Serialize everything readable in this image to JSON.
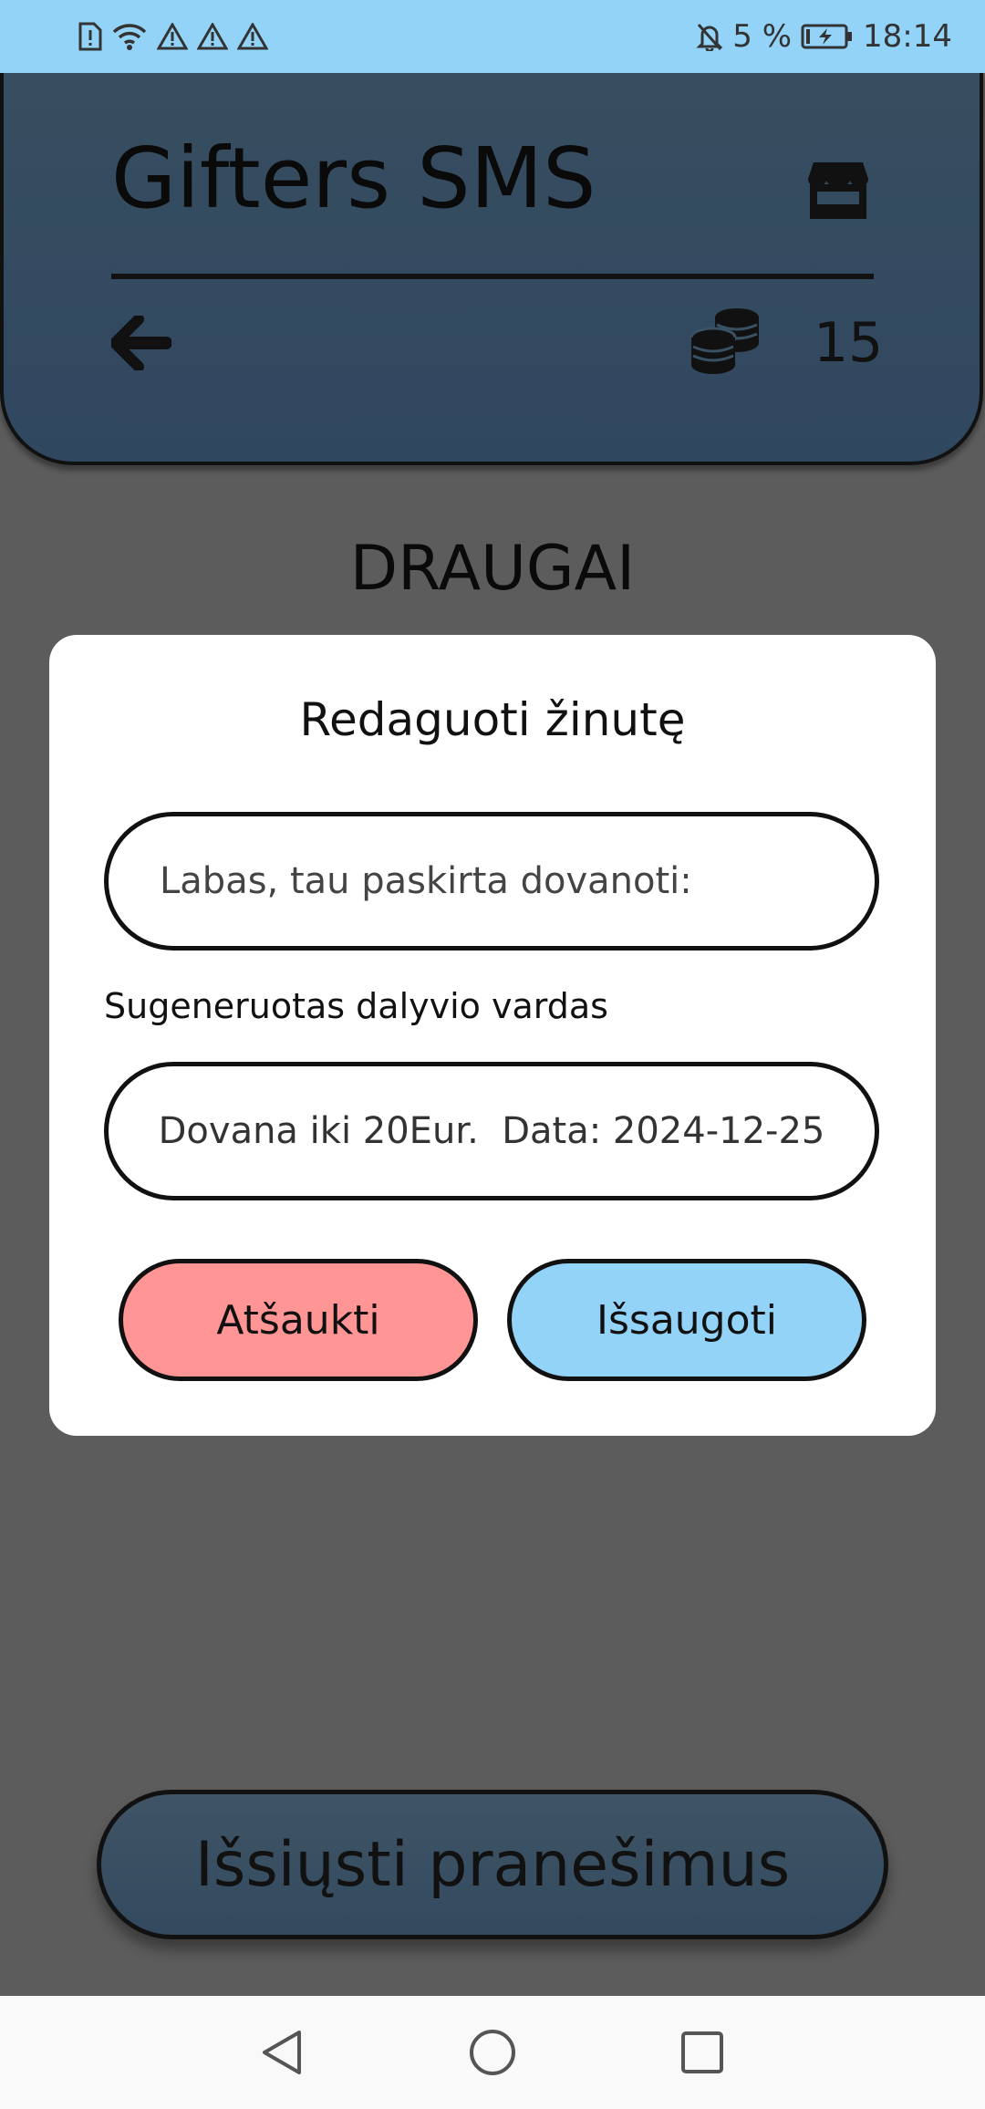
{
  "status_bar": {
    "battery_percent": "5 %",
    "time": "18:14",
    "left_icons": [
      "sim-alert-icon",
      "wifi-icon",
      "warning-icon",
      "warning-icon",
      "warning-icon"
    ],
    "right_icons": [
      "silent-bell-icon",
      "battery-charging-icon"
    ]
  },
  "header": {
    "title": "Gifters SMS",
    "coins": "15",
    "icons": [
      "store-icon",
      "back-arrow-icon",
      "coins-icon"
    ]
  },
  "section_title": "DRAUGAI",
  "dialog": {
    "title": "Redaguoti žinutę",
    "greeting_placeholder": "Labas, tau paskirta dovanoti:",
    "field_label": "Sugeneruotas dalyvio vardas",
    "details_value": "Dovana iki 20Eur.  Data: 2024-12-25",
    "cancel_label": "Atšaukti",
    "save_label": "Išsaugoti"
  },
  "send_button_label": "Išsiųsti pranešimus",
  "nav_bar": {
    "icons": [
      "back-triangle-icon",
      "home-circle-icon",
      "recents-square-icon"
    ]
  },
  "colors": {
    "status_bar": "#93d3f8",
    "header": "#344b60",
    "background": "#5c5c5c",
    "cancel": "#ff9594",
    "save": "#93d3f8"
  }
}
